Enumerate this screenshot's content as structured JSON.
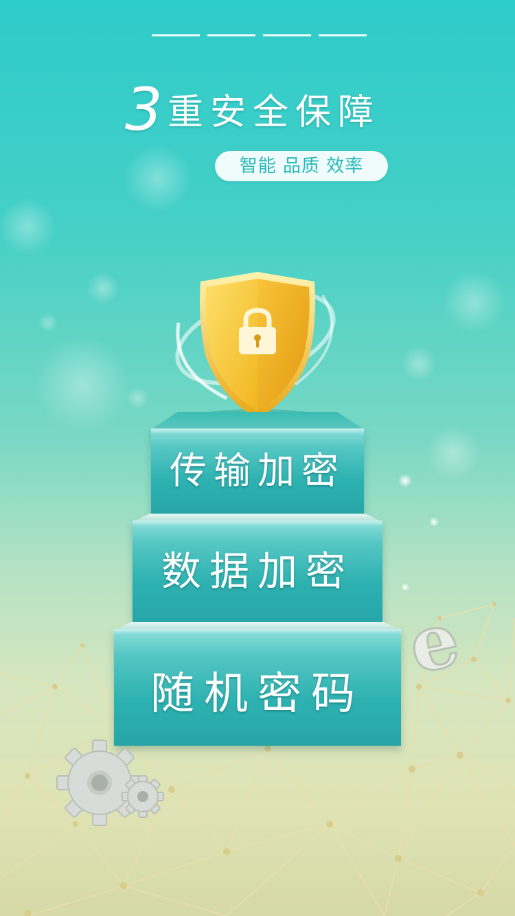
{
  "hero": {
    "number": "3",
    "title": "重安全保障",
    "tagline": "智能 品质 效率"
  },
  "steps": [
    {
      "label": "传输加密"
    },
    {
      "label": "数据加密"
    },
    {
      "label": "随机密码"
    }
  ],
  "icons": {
    "shield": "shield-lock-icon",
    "gear": "gear-icon",
    "letter": "e-letter-icon"
  },
  "colors": {
    "accent": "#2ecbcb",
    "step": "#2eb2b1",
    "shield": "#f5c52a"
  }
}
